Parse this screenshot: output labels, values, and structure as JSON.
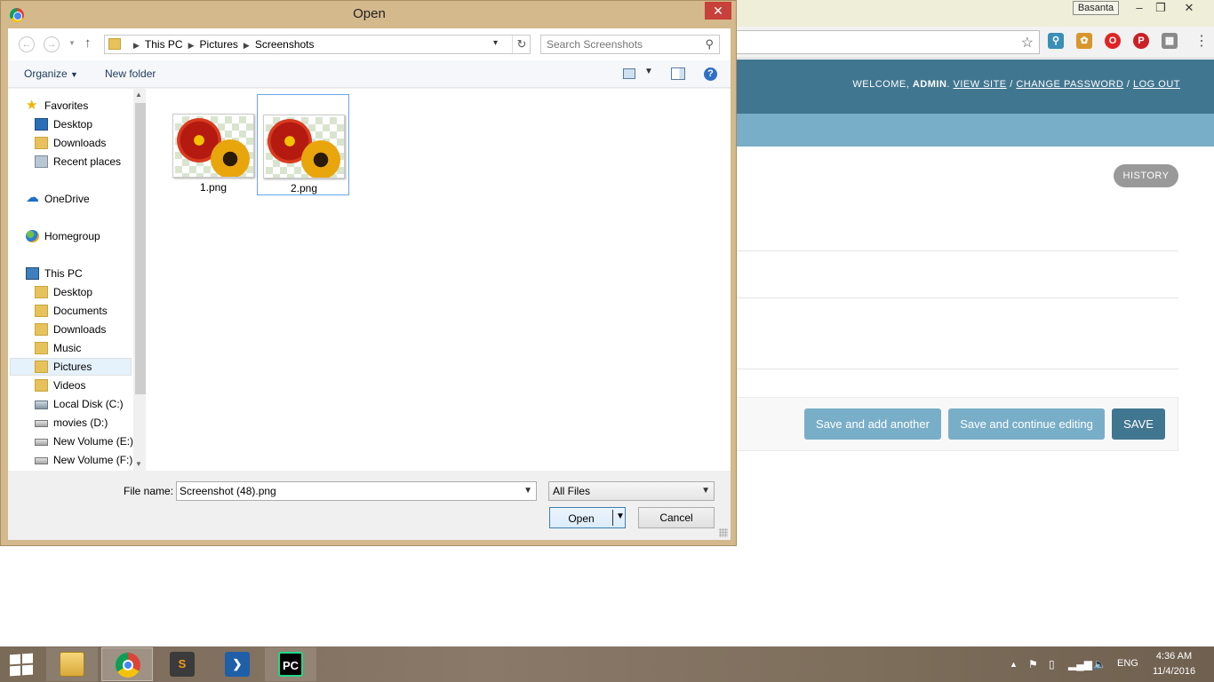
{
  "browser": {
    "profile_name": "Basanta",
    "admin": {
      "welcome": "WELCOME,",
      "username": "ADMIN",
      "view_site": "VIEW SITE",
      "change_password": "CHANGE PASSWORD",
      "log_out": "LOG OUT",
      "history": "HISTORY",
      "save_add_another": "Save and add another",
      "save_continue": "Save and continue editing",
      "save": "SAVE"
    },
    "colors": {
      "header": "#417690",
      "breadcrumbs": "#79aec8",
      "button_light": "#79aec8",
      "button_dark": "#417690"
    }
  },
  "dialog": {
    "title": "Open",
    "close_label": "✕",
    "breadcrumbs": [
      "This PC",
      "Pictures",
      "Screenshots"
    ],
    "search_placeholder": "Search Screenshots",
    "organize_label": "Organize",
    "new_folder_label": "New folder",
    "nav": {
      "favorites": "Favorites",
      "fav_desktop": "Desktop",
      "fav_downloads": "Downloads",
      "fav_recent": "Recent places",
      "onedrive": "OneDrive",
      "homegroup": "Homegroup",
      "this_pc": "This PC",
      "pc_desktop": "Desktop",
      "pc_documents": "Documents",
      "pc_downloads": "Downloads",
      "pc_music": "Music",
      "pc_pictures": "Pictures",
      "pc_videos": "Videos",
      "local_disk": "Local Disk (C:)",
      "movies": "movies (D:)",
      "new_vol_e": "New Volume (E:)",
      "new_vol_f": "New Volume (F:)"
    },
    "selected_nav_item": "Pictures",
    "files": [
      {
        "name": "1.png",
        "selected": false
      },
      {
        "name": "2.png",
        "selected": true
      }
    ],
    "file_name_label": "File name:",
    "file_name_value": "Screenshot (48).png",
    "file_type": "All Files",
    "open_label": "Open",
    "cancel_label": "Cancel"
  },
  "taskbar": {
    "apps": [
      "file-explorer",
      "chrome",
      "sublime-text",
      "powershell",
      "pycharm"
    ],
    "active_app": "chrome",
    "language": "ENG",
    "time": "4:36 AM",
    "date": "11/4/2016"
  }
}
